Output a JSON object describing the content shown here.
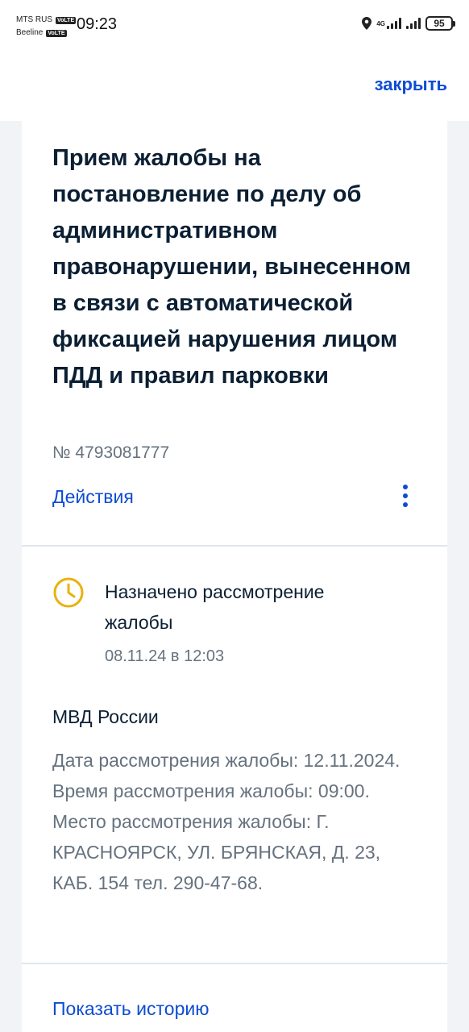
{
  "status_bar": {
    "carrier1": "MTS RUS",
    "carrier2": "Beeline",
    "volte_badge": "VoLTE",
    "time": "09:23",
    "network": "4G",
    "battery": "95"
  },
  "header": {
    "close_label": "закрыть"
  },
  "card": {
    "title": "Прием жалобы на постановление по делу об административном правонарушении, вынесенном в связи с автоматической фиксацией нарушения лицом ПДД и правил парковки",
    "number": "№ 4793081777",
    "actions_label": "Действия"
  },
  "status": {
    "icon": "clock-icon",
    "title": "Назначено рассмотрение жалобы",
    "date": "08.11.24 в 12:03"
  },
  "details": {
    "org": "МВД России",
    "text": "Дата рассмотрения жалобы: 12.11.2024. Время рассмотрения жалобы: 09:00. Место рассмотрения жалобы: Г. КРАСНОЯРСК, УЛ. БРЯНСКАЯ, Д. 23, КАБ. 154 тел. 290-47-68."
  },
  "footer": {
    "history_label": "Показать историю"
  },
  "colors": {
    "accent": "#0d4cd3",
    "warning": "#e8b20e",
    "muted_text": "#66727f"
  }
}
